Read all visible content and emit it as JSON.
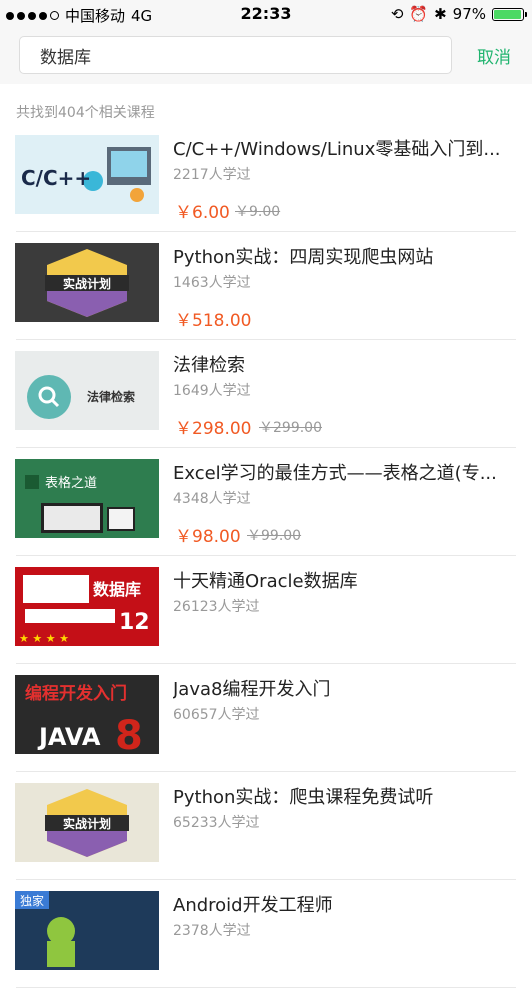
{
  "status": {
    "carrier": "中国移动",
    "network": "4G",
    "time": "22:33",
    "battery": "97%",
    "battery_level": 0.97
  },
  "search": {
    "value": "数据库",
    "cancel_label": "取消"
  },
  "result_count": "共找到404个相关课程",
  "courses": [
    {
      "title": "C/C++/Windows/Linux零基础入门到...",
      "learners": "2217人学过",
      "price": "￥6.00",
      "original": "￥9.00",
      "thumb_text": "C/C++"
    },
    {
      "title": "Python实战：四周实现爬虫网站",
      "learners": "1463人学过",
      "price": "￥518.00",
      "original": "",
      "thumb_text": "实战计划"
    },
    {
      "title": "法律检索",
      "learners": "1649人学过",
      "price": "￥298.00",
      "original": "￥299.00",
      "thumb_text": "法律检索"
    },
    {
      "title": "Excel学习的最佳方式——表格之道(专...",
      "learners": "4348人学过",
      "price": "￥98.00",
      "original": "￥99.00",
      "thumb_text": "表格之道"
    },
    {
      "title": "十天精通Oracle数据库",
      "learners": "26123人学过",
      "price": "",
      "original": "",
      "thumb_text": "数据库"
    },
    {
      "title": "Java8编程开发入门",
      "learners": "60657人学过",
      "price": "",
      "original": "",
      "thumb_text": "编程开发入门"
    },
    {
      "title": "Python实战：爬虫课程免费试听",
      "learners": "65233人学过",
      "price": "",
      "original": "",
      "thumb_text": "实战计划"
    },
    {
      "title": "Android开发工程师",
      "learners": "2378人学过",
      "price": "",
      "original": "",
      "thumb_text": "独家"
    }
  ]
}
